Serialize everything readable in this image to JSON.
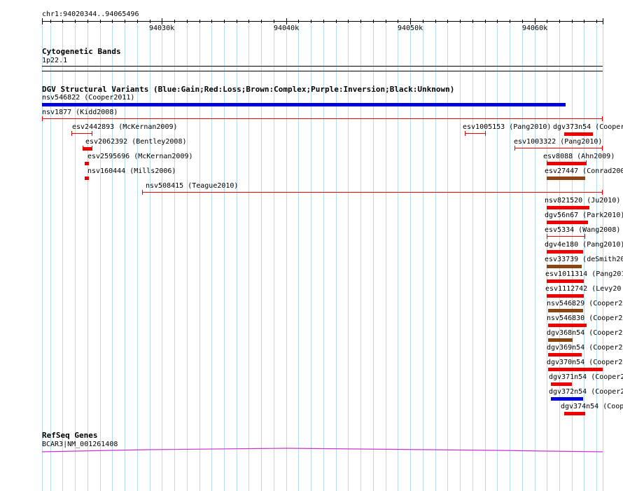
{
  "ruler": {
    "range": "chr1:94020344..94065496",
    "start": 94020344,
    "end": 94065496,
    "labels": [
      "94030k",
      "94040k",
      "94050k",
      "94060k"
    ]
  },
  "cytobands": {
    "title": "Cytogenetic Bands",
    "band": "1p22.1"
  },
  "dgv": {
    "title": "DGV Structural Variants (Blue:Gain;Red:Loss;Brown:Complex;Purple:Inversion;Black:Unknown)",
    "colors": {
      "gain": "#0000dd",
      "loss": "#ee0000",
      "complex": "#8b4513",
      "inversion": "#800080",
      "unknown": "#000000"
    },
    "variants": [
      {
        "label": "nsv546822 (Cooper2011)",
        "start": 94020344,
        "end": 94062500,
        "type": "gain",
        "style": "thick"
      },
      {
        "label": "nsv1877 (Kidd2008)",
        "start": 94020344,
        "end": 94065496,
        "type": "loss",
        "style": "thin"
      },
      {
        "label": "esv2442893 (McKernan2009)",
        "start": 94022700,
        "end": 94024400,
        "type": "loss",
        "style": "thin"
      },
      {
        "label": "esv1005153 (Pang2010)",
        "start": 94054400,
        "end": 94056100,
        "type": "loss",
        "style": "thin"
      },
      {
        "label": "dgv373n54 (Cooper",
        "start": 94062400,
        "end": 94064700,
        "type": "loss",
        "style": "thick"
      },
      {
        "label": "esv2062392 (Bentley2008)",
        "start": 94023600,
        "end": 94024400,
        "type": "loss",
        "style": "thick-ticks"
      },
      {
        "label": "esv1003322 (Pang2010)",
        "start": 94058400,
        "end": 94065496,
        "type": "loss",
        "style": "thin"
      },
      {
        "label": "esv2595696 (McKernan2009)",
        "start": 94023800,
        "end": 94024100,
        "type": "loss",
        "style": "thick"
      },
      {
        "label": "esv8088 (Ahn2009)",
        "start": 94061000,
        "end": 94064200,
        "type": "loss",
        "style": "thick-ticks"
      },
      {
        "label": "nsv160444 (Mills2006)",
        "start": 94023800,
        "end": 94024100,
        "type": "loss",
        "style": "thick"
      },
      {
        "label": "esv27447 (Conrad200",
        "start": 94061000,
        "end": 94064100,
        "type": "complex",
        "style": "thick"
      },
      {
        "label": "nsv508415 (Teague2010)",
        "start": 94028400,
        "end": 94065496,
        "type": "loss",
        "style": "thin"
      },
      {
        "label": "nsv821520 (Ju2010)",
        "start": 94061000,
        "end": 94064400,
        "type": "loss",
        "style": "thick"
      },
      {
        "label": "dgv56n67 (Park2010)",
        "start": 94061000,
        "end": 94064300,
        "type": "loss",
        "style": "thick"
      },
      {
        "label": "esv5334 (Wang2008)",
        "start": 94061000,
        "end": 94064100,
        "type": "loss",
        "style": "thin"
      },
      {
        "label": "dgv4e180 (Pang2010)",
        "start": 94061000,
        "end": 94063900,
        "type": "loss",
        "style": "thick"
      },
      {
        "label": "esv33739 (deSmith20",
        "start": 94061000,
        "end": 94063800,
        "type": "complex",
        "style": "thick"
      },
      {
        "label": "esv1011314 (Pang201",
        "start": 94061000,
        "end": 94064000,
        "type": "loss",
        "style": "thick"
      },
      {
        "label": "esv1112742 (Levy20",
        "start": 94061000,
        "end": 94064000,
        "type": "loss",
        "style": "thick"
      },
      {
        "label": "nsv546829 (Cooper2",
        "start": 94061100,
        "end": 94063900,
        "type": "complex",
        "style": "thick"
      },
      {
        "label": "nsv546830 (Cooper2",
        "start": 94061100,
        "end": 94064200,
        "type": "loss",
        "style": "thick"
      },
      {
        "label": "dgv368n54 (Cooper2",
        "start": 94061100,
        "end": 94063100,
        "type": "complex",
        "style": "thick"
      },
      {
        "label": "dgv369n54 (Cooper2",
        "start": 94061100,
        "end": 94063800,
        "type": "loss",
        "style": "thick"
      },
      {
        "label": "dgv370n54 (Cooper2",
        "start": 94061100,
        "end": 94065496,
        "type": "loss",
        "style": "thick"
      },
      {
        "label": "dgv371n54 (Cooper2",
        "start": 94061300,
        "end": 94063000,
        "type": "loss",
        "style": "thick"
      },
      {
        "label": "dgv372n54 (Cooper2",
        "start": 94061300,
        "end": 94063900,
        "type": "gain",
        "style": "thick"
      },
      {
        "label": "dgv374n54 (Coop",
        "start": 94062400,
        "end": 94064100,
        "type": "loss",
        "style": "thick"
      }
    ]
  },
  "refseq": {
    "title": "RefSeq Genes",
    "gene": "BCAR3|NM_001261408",
    "color": "#cc33cc"
  }
}
